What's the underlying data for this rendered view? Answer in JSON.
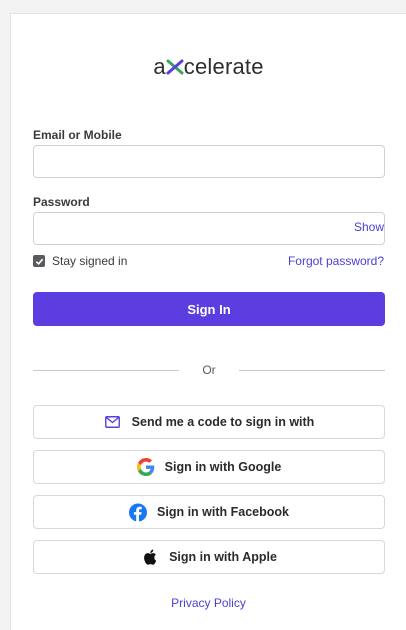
{
  "logo": {
    "left": "a",
    "right": "celerate"
  },
  "email": {
    "label": "Email or Mobile",
    "value": "",
    "placeholder": ""
  },
  "password": {
    "label": "Password",
    "value": "",
    "placeholder": "",
    "show_label": "Show"
  },
  "remember": {
    "label": "Stay signed in",
    "checked": true
  },
  "forgot_label": "Forgot password?",
  "signin_label": "Sign In",
  "divider_label": "Or",
  "alt_buttons": {
    "code": "Send me a code to sign in with",
    "google": "Sign in with Google",
    "facebook": "Sign in with Facebook",
    "apple": "Sign in with Apple"
  },
  "privacy_label": "Privacy Policy",
  "colors": {
    "accent": "#5c3de0",
    "link": "#4b3fd8",
    "logo_x": "#3aa655"
  }
}
